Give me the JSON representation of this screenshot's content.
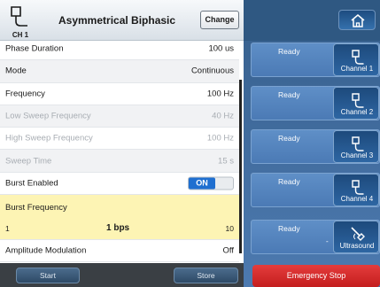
{
  "header": {
    "channel_label": "CH 1",
    "title": "Asymmetrical Biphasic",
    "change_label": "Change"
  },
  "parameters": [
    {
      "label": "Phase Duration",
      "value": "100 us"
    },
    {
      "label": "Mode",
      "value": "Continuous"
    },
    {
      "label": "Frequency",
      "value": "100 Hz"
    },
    {
      "label": "Low Sweep Frequency",
      "value": "40 Hz"
    },
    {
      "label": "High Sweep Frequency",
      "value": "100 Hz"
    },
    {
      "label": "Sweep Time",
      "value": "15 s"
    },
    {
      "label": "Burst Enabled",
      "value": "ON"
    },
    {
      "label": "Amplitude Modulation",
      "value": "Off"
    }
  ],
  "burst": {
    "label": "Burst Frequency",
    "min": "1",
    "value": "1 bps",
    "max": "10"
  },
  "footer": {
    "start_label": "Start",
    "store_label": "Store",
    "emergency_label": "Emergency Stop"
  },
  "channels": [
    {
      "status": "Ready",
      "name": "Channel 1",
      "icon": "electrode-icon"
    },
    {
      "status": "Ready",
      "name": "Channel 2",
      "icon": "electrode-icon"
    },
    {
      "status": "Ready",
      "name": "Channel 3",
      "icon": "electrode-icon"
    },
    {
      "status": "Ready",
      "name": "Channel 4",
      "icon": "electrode-icon"
    },
    {
      "status": "Ready",
      "dash": "-",
      "name": "Ultrasound",
      "icon": "ultrasound-probe-icon"
    }
  ],
  "colors": {
    "accent": "#1f6fd0",
    "burst_highlight": "#fdf4b4",
    "emergency": "#d62b2b",
    "panel_blue": "#4b7ab5"
  }
}
